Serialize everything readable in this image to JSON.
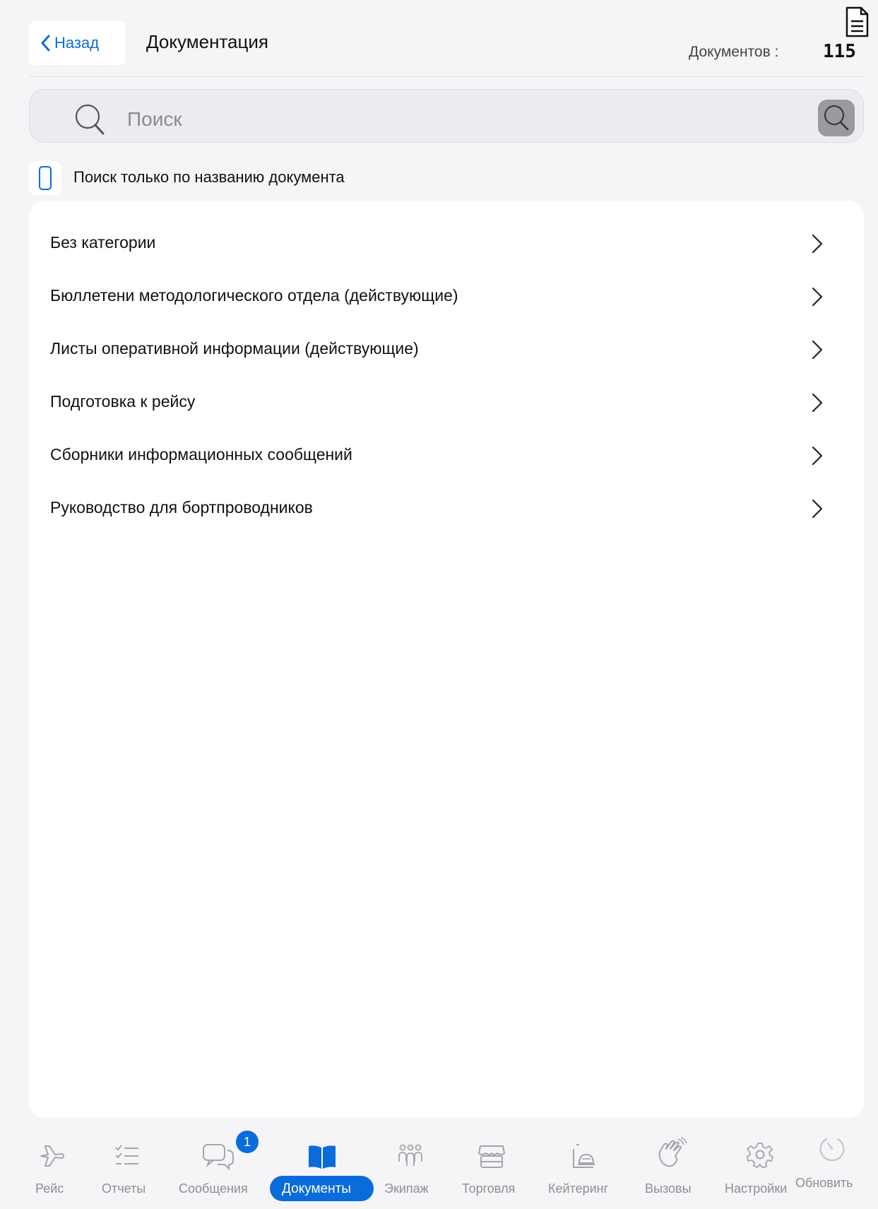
{
  "header": {
    "back_label": "Назад",
    "title": "Документация",
    "doc_count_label": "Документов :",
    "doc_count_value": "115"
  },
  "search": {
    "placeholder": "Поиск",
    "value": "",
    "title_only_label": "Поиск только по названию документа",
    "title_only_checked": false
  },
  "categories": [
    {
      "label": "Без категории"
    },
    {
      "label": "Бюллетени методологического отдела (действующие)"
    },
    {
      "label": "Листы оперативной информации (действующие)"
    },
    {
      "label": "Подготовка к рейсу"
    },
    {
      "label": "Сборники информационных сообщений"
    },
    {
      "label": "Руководство для бортпроводников"
    }
  ],
  "tabbar": {
    "accent_color": "#0a6cdb",
    "inactive_color": "#8e8e93",
    "active_tab": "Документы",
    "items": [
      {
        "label": "Рейс",
        "icon": "airplane-icon"
      },
      {
        "label": "Отчеты",
        "icon": "checklist-icon"
      },
      {
        "label": "Сообщения",
        "icon": "chat-bubbles-icon",
        "badge": "1"
      },
      {
        "label": "Документы",
        "icon": "book-icon"
      },
      {
        "label": "Экипаж",
        "icon": "crew-icon"
      },
      {
        "label": "Торговля",
        "icon": "shop-icon"
      },
      {
        "label": "Кейтеринг",
        "icon": "catering-icon"
      },
      {
        "label": "Вызовы",
        "icon": "hand-icon"
      },
      {
        "label": "Настройки",
        "icon": "gear-icon"
      },
      {
        "label": "Обновить",
        "icon": "refresh-icon"
      }
    ]
  }
}
